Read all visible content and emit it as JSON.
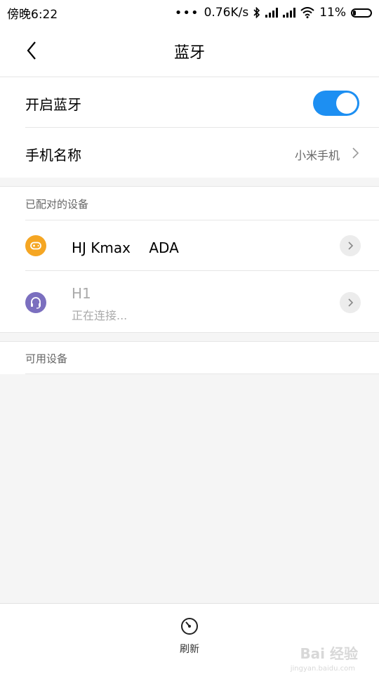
{
  "status_bar": {
    "time": "傍晚6:22",
    "dots": "•••",
    "net_speed": "0.76K/s",
    "battery_pct": "11%",
    "icons": [
      "bluetooth-icon",
      "signal-icon",
      "signal-icon",
      "wifi-icon",
      "battery-icon"
    ]
  },
  "header": {
    "title": "蓝牙",
    "back_icon": "chevron-left-icon"
  },
  "settings": {
    "bluetooth_toggle_label": "开启蓝牙",
    "bluetooth_on": true,
    "phone_name_label": "手机名称",
    "phone_name_value": "小米手机"
  },
  "paired": {
    "header": "已配对的设备",
    "devices": [
      {
        "name": "HJ Kmax　 ADA",
        "status": "",
        "icon": "gamepad-icon",
        "icon_color": "#f5a623"
      },
      {
        "name": "H1",
        "status": "正在连接...",
        "icon": "headset-icon",
        "icon_color": "#7b6fbf"
      }
    ]
  },
  "available": {
    "header": "可用设备"
  },
  "bottom": {
    "refresh_label": "刷新",
    "refresh_icon": "refresh-icon"
  },
  "watermark": {
    "brand": "Bai 经验",
    "url": "jingyan.baidu.com"
  },
  "colors": {
    "accent": "#1d8ff2"
  }
}
